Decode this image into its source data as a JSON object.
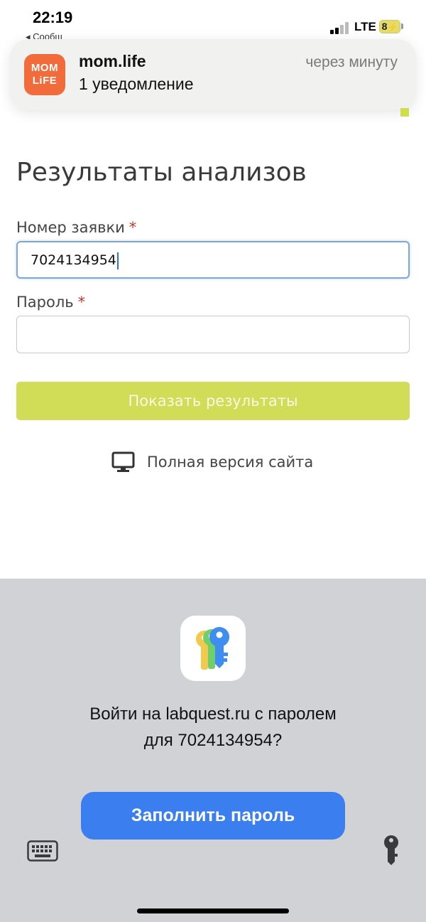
{
  "status_bar": {
    "time": "22:19",
    "back_hint": "◂ Сообщ",
    "network": "LTE",
    "battery": "8"
  },
  "notification": {
    "app_icon_line1": "MOM",
    "app_icon_line2": "LiFE",
    "app_name": "mom.life",
    "body": "1 уведомление",
    "time": "через минуту"
  },
  "form": {
    "title": "Результаты анализов",
    "order_label": "Номер заявки",
    "order_value": "7024134954",
    "password_label": "Пароль",
    "password_value": "",
    "required_mark": "*",
    "submit_label": "Показать результаты",
    "full_version_label": "Полная версия сайта"
  },
  "password_sheet": {
    "prompt_line1": "Войти на labquest.ru с паролем",
    "prompt_line2": "для 7024134954?",
    "fill_button_label": "Заполнить пароль"
  },
  "colors": {
    "submit_button": "#d1dc57",
    "fill_button": "#3a7ef0",
    "app_icon": "#f26b3a",
    "sheet_background": "#d1d2d6"
  },
  "icons": {
    "notification_app": "mom-life-app-icon",
    "full_version": "monitor-icon",
    "sheet_app": "passwords-keys-icon",
    "keyboard": "keyboard-icon",
    "key": "key-icon"
  }
}
